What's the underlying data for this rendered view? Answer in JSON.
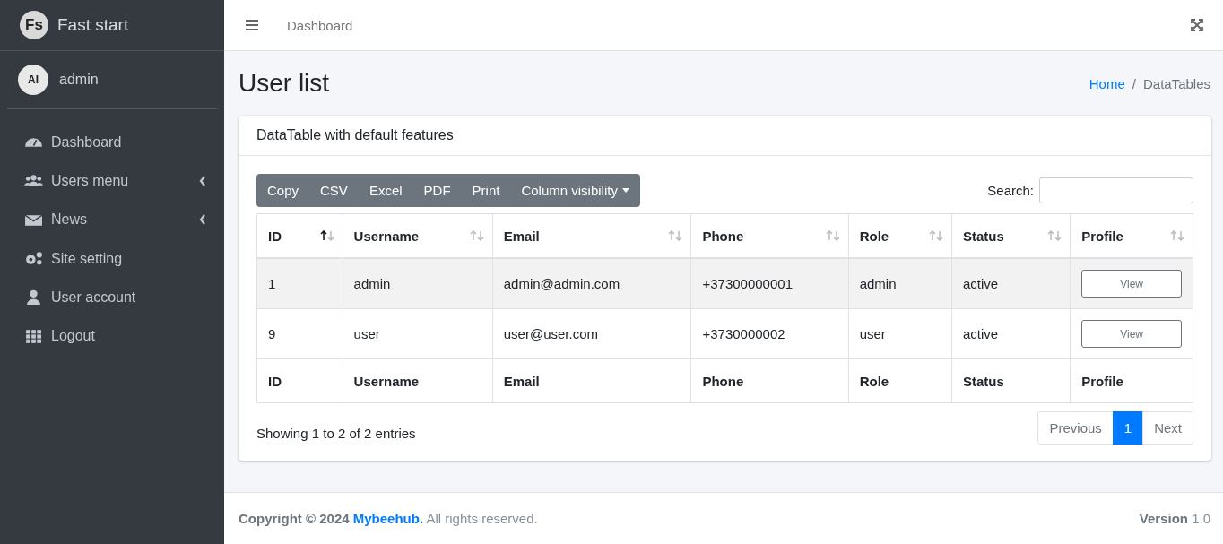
{
  "brand": {
    "logo": "Fs",
    "name": "Fast start"
  },
  "user": {
    "avatar": "AI",
    "name": "admin"
  },
  "sidebar": {
    "items": [
      {
        "label": "Dashboard",
        "has_submenu": false
      },
      {
        "label": "Users menu",
        "has_submenu": true
      },
      {
        "label": "News",
        "has_submenu": true
      },
      {
        "label": "Site setting",
        "has_submenu": false
      },
      {
        "label": "User account",
        "has_submenu": false
      },
      {
        "label": "Logout",
        "has_submenu": false
      }
    ]
  },
  "topbar": {
    "link": "Dashboard"
  },
  "page": {
    "title": "User list",
    "breadcrumb_separator": "/",
    "breadcrumb": [
      {
        "label": "Home",
        "current": false
      },
      {
        "label": "DataTables",
        "current": true
      }
    ]
  },
  "card": {
    "title": "DataTable with default features",
    "buttons": [
      {
        "label": "Copy",
        "kind": "plain"
      },
      {
        "label": "CSV",
        "kind": "plain"
      },
      {
        "label": "Excel",
        "kind": "plain"
      },
      {
        "label": "PDF",
        "kind": "plain"
      },
      {
        "label": "Print",
        "kind": "plain"
      },
      {
        "label": "Column visibility",
        "kind": "dropdown"
      }
    ],
    "search": {
      "label": "Search:"
    },
    "table": {
      "columns": [
        {
          "label": "ID",
          "sorted": true
        },
        {
          "label": "Username",
          "sorted": false
        },
        {
          "label": "Email",
          "sorted": false
        },
        {
          "label": "Phone",
          "sorted": false
        },
        {
          "label": "Role",
          "sorted": false
        },
        {
          "label": "Status",
          "sorted": false
        },
        {
          "label": "Profile",
          "sorted": false
        }
      ],
      "rows": [
        {
          "cells": [
            "1",
            "admin",
            "admin@admin.com",
            "+37300000001",
            "admin",
            "active"
          ],
          "action": "View"
        },
        {
          "cells": [
            "9",
            "user",
            "user@user.com",
            "+3730000002",
            "user",
            "active"
          ],
          "action": "View"
        }
      ],
      "footer": [
        "ID",
        "Username",
        "Email",
        "Phone",
        "Role",
        "Status",
        "Profile"
      ]
    },
    "info": "Showing 1 to 2 of 2 entries",
    "pagination": [
      {
        "label": "Previous",
        "selected": false
      },
      {
        "label": "1",
        "selected": true
      },
      {
        "label": "Next",
        "selected": false
      }
    ]
  },
  "footer": {
    "prefix": "Copyright © 2024",
    "link": "Mybeehub.",
    "suffix": "All rights reserved.",
    "version": "**Version** 1.0"
  }
}
